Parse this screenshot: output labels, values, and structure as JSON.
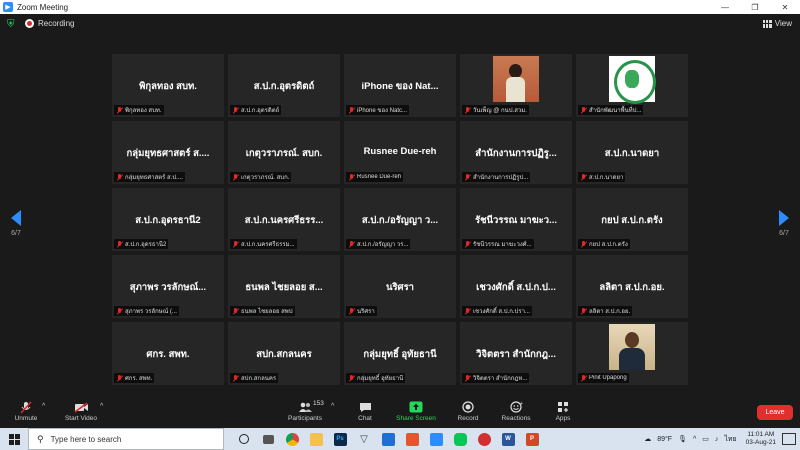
{
  "window": {
    "title": "Zoom Meeting"
  },
  "topbar": {
    "recording_label": "Recording",
    "view_label": "View"
  },
  "pager": {
    "left": "6/7",
    "right": "6/7"
  },
  "tiles": [
    {
      "big": "พิกุลทอง สบท.",
      "small": "พิกุลทอง สบท.",
      "photo": ""
    },
    {
      "big": "ส.ป.ก.อุตรดิตถ์",
      "small": "ส.ป.ก.อุตรดิตถ์",
      "photo": ""
    },
    {
      "big": "iPhone ของ Nat...",
      "small": "iPhone ของ Natc...",
      "photo": ""
    },
    {
      "big": "",
      "small": "วันเพ็ญ @ กนป.สวม.",
      "photo": "woman"
    },
    {
      "big": "",
      "small": "สำนักพัฒนาพื้นที่ป...",
      "photo": "logo"
    },
    {
      "big": "กลุ่มยุทธศาสตร์ ส....",
      "small": "กลุ่มยุทธศาสตร์ ส.ป....",
      "photo": ""
    },
    {
      "big": "เกตุวราภรณ์. สบก.",
      "small": "เกตุวราภรณ์. สบก.",
      "photo": ""
    },
    {
      "big": "Rusnee Due-reh",
      "small": "Rusnee Due-reh",
      "photo": ""
    },
    {
      "big": "สำนักงานการปฏิรู...",
      "small": "สำนักงานการปฏิรูป...",
      "photo": ""
    },
    {
      "big": "ส.ป.ก.นาดยา",
      "small": "ส.ป.ก.นาดยา",
      "photo": ""
    },
    {
      "big": "ส.ป.ก.อุดรธานี2",
      "small": "ส.ป.ก.อุดรธานี2",
      "photo": ""
    },
    {
      "big": "ส.ป.ก.นครศรีธรร...",
      "small": "ส.ป.ก.นครศรีธรรม...",
      "photo": ""
    },
    {
      "big": "ส.ป.ก./อรัญญา ว...",
      "small": "ส.ป.ก./อรัญญา วร...",
      "photo": ""
    },
    {
      "big": "รัชนีวรรณ มาฆะว...",
      "small": "รัชนีวรรณ มาฆะวงศ์...",
      "photo": ""
    },
    {
      "big": "กยป ส.ป.ก.ตรัง",
      "small": "กยป ส.ป.ก.ตรัง",
      "photo": ""
    },
    {
      "big": "สุภาพร วรลักษณ์...",
      "small": "สุภาพร วรลักษณ์ (...",
      "photo": ""
    },
    {
      "big": "ธนพล ไชยลอย ส...",
      "small": "ธนพล ไชยลอย สพป",
      "photo": ""
    },
    {
      "big": "นริศรา",
      "small": "นริศรา",
      "photo": ""
    },
    {
      "big": "เชวงศักดิ์ ส.ป.ก.ป...",
      "small": "เชวงศักดิ์ ส.ป.ก.ปรา...",
      "photo": ""
    },
    {
      "big": "ลลิตา ส.ป.ก.อย.",
      "small": "ลลิตา ส.ป.ก.อย.",
      "photo": ""
    },
    {
      "big": "ศกร. สพท.",
      "small": "ศกร. สพท.",
      "photo": ""
    },
    {
      "big": "สปก.สกลนคร",
      "small": "สปก.สกลนคร",
      "photo": ""
    },
    {
      "big": "กลุ่มยุทธิ์ อุทัยธานี",
      "small": "กลุ่มยุทธิ์ อุทัยธานี",
      "photo": ""
    },
    {
      "big": "วิจิตตรา สำนักกฎ...",
      "small": "วิจิตตรา สำนักกฎห...",
      "photo": ""
    },
    {
      "big": "",
      "small": "Pinit Upapong",
      "photo": "man"
    }
  ],
  "toolbar": {
    "unmute": "Unmute",
    "start_video": "Start Video",
    "participants": "Participants",
    "participants_count": "153",
    "chat": "Chat",
    "share_screen": "Share Screen",
    "record": "Record",
    "reactions": "Reactions",
    "apps": "Apps",
    "leave": "Leave"
  },
  "taskbar": {
    "search_placeholder": "Type here to search",
    "temperature": "89°F",
    "language": "ไทย",
    "time": "11:01 AM",
    "date": "03-Aug-21"
  },
  "colors": {
    "accent": "#2d8cff",
    "share_green": "#23d959",
    "leave_red": "#e0302e",
    "muted_red": "#e02828"
  }
}
